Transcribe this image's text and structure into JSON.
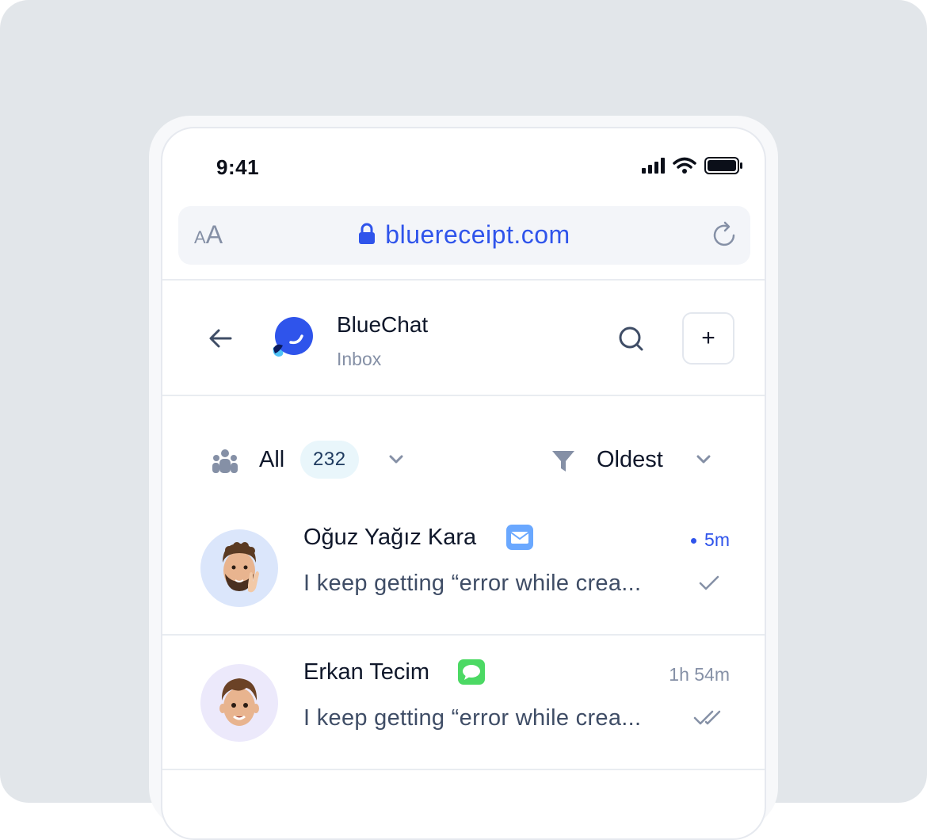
{
  "status_bar": {
    "time": "9:41"
  },
  "browser": {
    "text_size_small": "A",
    "text_size_large": "A",
    "url": "bluereceipt.com",
    "lock_icon": "lock-icon",
    "reload_icon": "reload-icon"
  },
  "header": {
    "title": "BlueChat",
    "subtitle": "Inbox",
    "back_icon": "arrow-left-icon",
    "search_icon": "search-icon",
    "add_label": "+"
  },
  "filters": {
    "group_label": "All",
    "group_count": "232",
    "sort_label": "Oldest"
  },
  "conversations": [
    {
      "name": "Oğuz Yağız Kara",
      "channel": "email",
      "time": "5m",
      "unread": true,
      "preview": "I keep getting “error while crea...",
      "status": "sent"
    },
    {
      "name": "Erkan Tecim",
      "channel": "messages",
      "time": "1h 54m",
      "unread": false,
      "preview": "I keep getting “error while crea...",
      "status": "read"
    }
  ],
  "colors": {
    "accent": "#2f54eb",
    "background": "#e2e6ea",
    "muted": "#8590a6"
  }
}
